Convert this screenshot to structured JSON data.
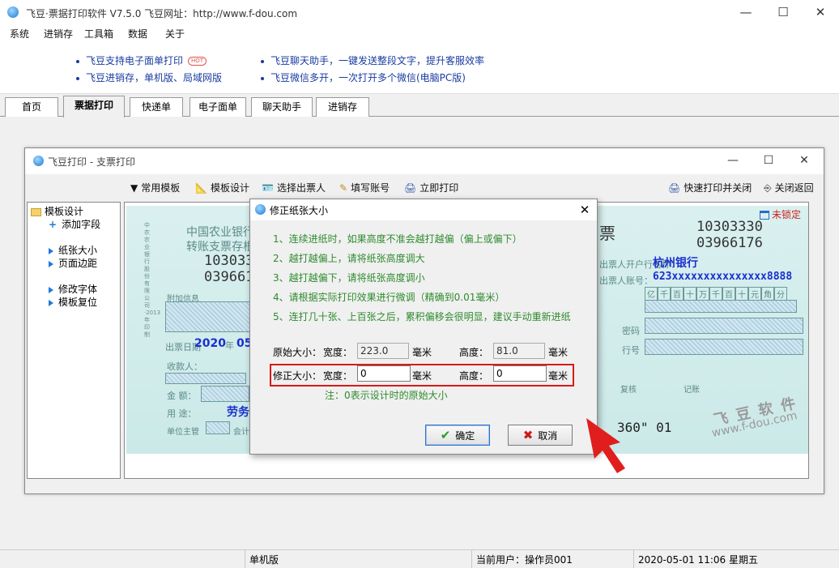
{
  "window": {
    "title": "飞豆·票据打印软件 V7.5.0   飞豆网址：http://www.f-dou.com",
    "minimize": "—",
    "maximize": "☐",
    "close": "✕"
  },
  "menu": [
    "系统",
    "进销存",
    "工具箱",
    "数据",
    "关于"
  ],
  "ads": {
    "left1": "飞豆支持电子面单打印",
    "hot": "HOT",
    "left2": "飞豆进销存，单机版、局域网版",
    "right1": "飞豆聊天助手，一键发送整段文字，提升客服效率",
    "right2": "飞豆微信多开，一次打开多个微信(电脑PC版)"
  },
  "tabs": [
    "首页",
    "票据打印",
    "快递单",
    "电子面单",
    "聊天助手",
    "进销存"
  ],
  "inner": {
    "title": "飞豆打印 - 支票打印",
    "toolbar": {
      "templates": "常用模板",
      "design": "模板设计",
      "issuer": "选择出票人",
      "account": "填写账号",
      "print": "立即打印",
      "quick": "快速打印并关闭",
      "back": "关闭返回"
    },
    "tree": {
      "root": "模板设计",
      "add_field": "添加字段",
      "paper_size": "纸张大小",
      "page_margin": "页面边距",
      "font": "修改字体",
      "reset": "模板复位"
    }
  },
  "check": {
    "bank_left": "中国农业银行",
    "stub_title": "转账支票存根",
    "num1": "10303330",
    "num2": "03966176",
    "extra": "附加信息",
    "date_label": "出票日期",
    "date_year": "2020",
    "year_char": "年",
    "date_month": "05",
    "payee": "收款人：",
    "amount": "金  额：",
    "usage": "用  途：",
    "usage_val": "劳务费",
    "supervisor": "单位主管",
    "accountant": "会计",
    "title_right": "票",
    "num_r1": "10303330",
    "num_r2": "03966176",
    "payer_bank_label": "出票人开户行名称：",
    "payer_bank": "杭州银行",
    "payer_acct_label": "出票人账号：",
    "payer_acct": "623xxxxxxxxxxxxxxx8888",
    "digits": [
      "亿",
      "千",
      "百",
      "十",
      "万",
      "千",
      "百",
      "十",
      "元",
      "角",
      "分"
    ],
    "pwd": "密码",
    "line_no": "行号",
    "review": "复核",
    "bookkeep": "记账",
    "micr": "360\" 01",
    "unlocked": "未锁定",
    "side_text": "中农农业银行股份有限公司·2013年印制",
    "watermark_cn": "飞 豆 软 件",
    "watermark_url": "www.f-dou.com"
  },
  "dialog": {
    "title": "修正纸张大小",
    "tips": [
      "1、连续进纸时，如果高度不准会越打越偏（偏上或偏下）",
      "2、越打越偏上，请将纸张高度调大",
      "3、越打越偏下，请将纸张高度调小",
      "4、请根据实际打印效果进行微调（精确到0.01毫米）",
      "5、连打几十张、上百张之后，累积偏移会很明显，建议手动重新进纸"
    ],
    "orig_label": "原始大小：",
    "width_label": "宽度：",
    "height_label": "高度：",
    "unit": "毫米",
    "orig_width": "223.0",
    "orig_height": "81.0",
    "fix_label": "修正大小：",
    "fix_width": "0",
    "fix_height": "0",
    "note": "注：0表示设计时的原始大小",
    "ok": "确定",
    "cancel": "取消"
  },
  "status": {
    "edition": "单机版",
    "user": "当前用户：操作员001",
    "datetime": "2020-05-01 11:06 星期五"
  }
}
